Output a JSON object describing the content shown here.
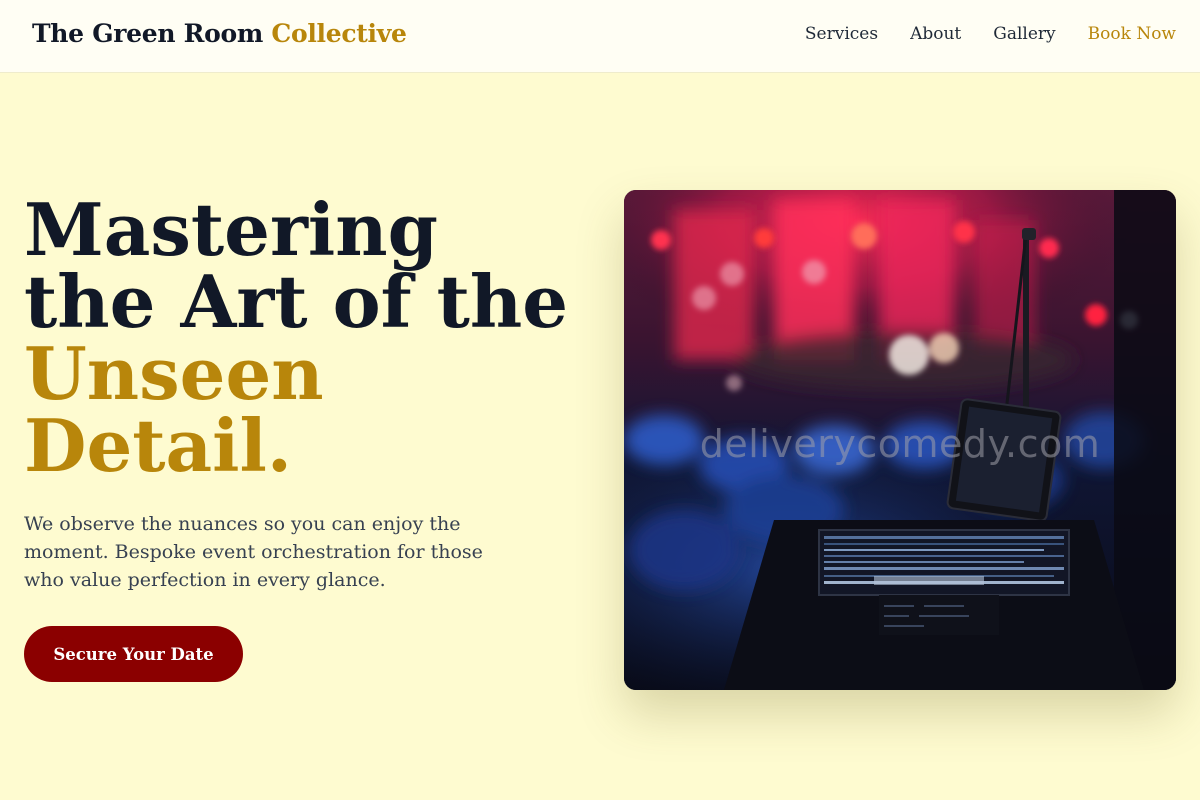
{
  "brand": {
    "name_main": "The Green Room",
    "name_accent": "Collective"
  },
  "nav": {
    "items": [
      {
        "label": "Services"
      },
      {
        "label": "About"
      },
      {
        "label": "Gallery"
      },
      {
        "label": "Book Now"
      }
    ]
  },
  "hero": {
    "title_line1": "Mastering",
    "title_line2": "the Art of the",
    "title_line3": "Unseen",
    "title_line4": "Detail.",
    "subtitle": "We observe the nuances so you can enjoy the moment. Bespoke event orchestration for those who value perfection in every glance.",
    "cta_label": "Secure Your Date"
  },
  "image": {
    "watermark": "deliverycomedy.com"
  },
  "colors": {
    "background": "#fefbd0",
    "navbar": "#fffef4",
    "accent_gold": "#b8860b",
    "cta_red": "#8b0000",
    "text_dark": "#111827"
  }
}
